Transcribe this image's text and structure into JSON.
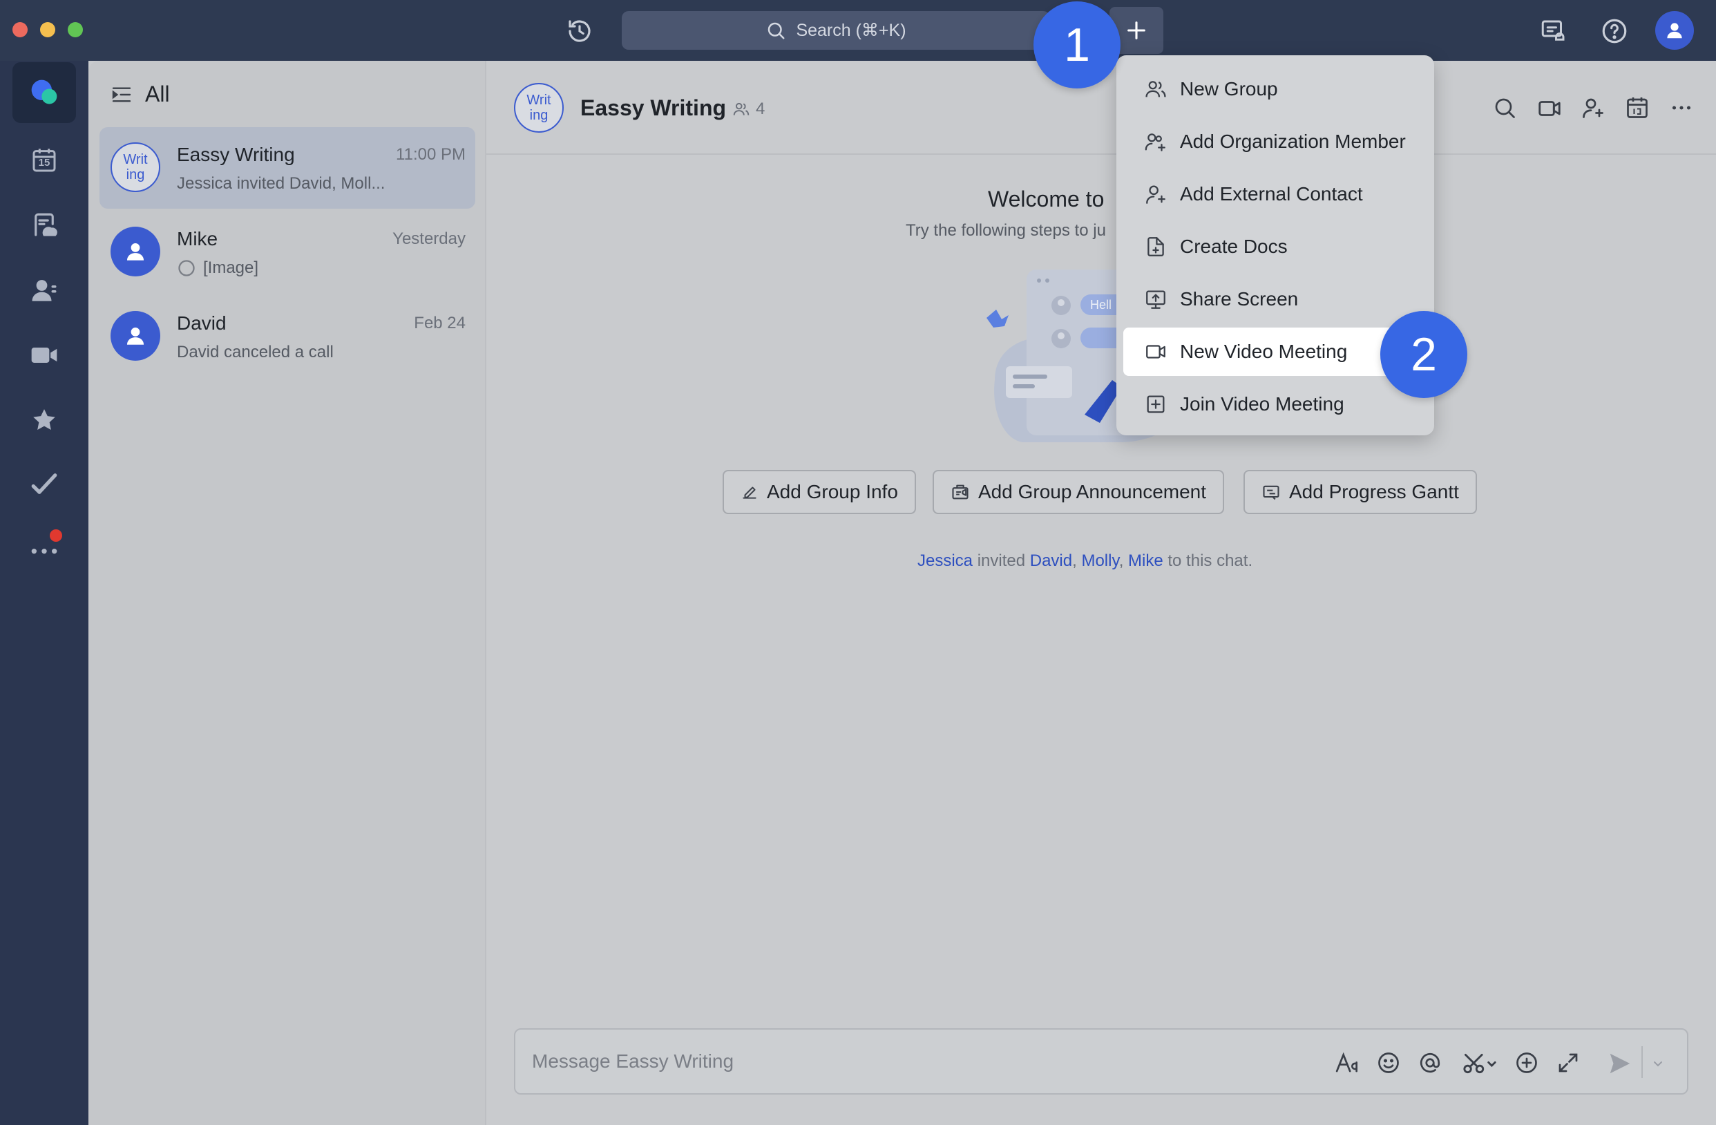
{
  "titlebar": {
    "search_label": "Search (⌘+K)"
  },
  "nav": {
    "calendar_day": "15"
  },
  "chat_list": {
    "header": "All",
    "items": [
      {
        "avatar_line1": "Writ",
        "avatar_line2": "ing",
        "name": "Eassy Writing",
        "time": "11:00 PM",
        "preview": "Jessica invited David, Moll..."
      },
      {
        "name": "Mike",
        "time": "Yesterday",
        "preview": "[Image]"
      },
      {
        "name": "David",
        "time": "Feb 24",
        "preview": "David canceled a call"
      }
    ]
  },
  "chat": {
    "avatar_line1": "Writ",
    "avatar_line2": "ing",
    "title": "Eassy Writing",
    "member_count": "4",
    "welcome_title": "Welcome to",
    "welcome_sub": "Try the following steps to ju",
    "illustration_text": "Hell",
    "actions": {
      "group_info": "Add Group Info",
      "announcement": "Add Group Announcement",
      "gantt": "Add Progress Gantt"
    },
    "system_message": {
      "actor": "Jessica",
      "verb": "invited",
      "member1": "David",
      "member2": "Molly",
      "member3": "Mike",
      "suffix": "to this chat."
    },
    "composer_placeholder": "Message Eassy Writing"
  },
  "dropdown": {
    "items": [
      {
        "label": "New Group",
        "icon": "group-icon"
      },
      {
        "label": "Add Organization Member",
        "icon": "org-member-icon"
      },
      {
        "label": "Add External Contact",
        "icon": "external-contact-icon"
      },
      {
        "label": "Create Docs",
        "icon": "docs-icon"
      },
      {
        "label": "Share Screen",
        "icon": "share-screen-icon"
      },
      {
        "label": "New Video Meeting",
        "icon": "video-camera-icon"
      },
      {
        "label": "Join Video Meeting",
        "icon": "join-meeting-icon"
      }
    ]
  },
  "badges": {
    "step1": "1",
    "step2": "2"
  },
  "colors": {
    "titlebar": "#2e3a52",
    "accent": "#3b5bcf",
    "badge": "#3767e4"
  }
}
